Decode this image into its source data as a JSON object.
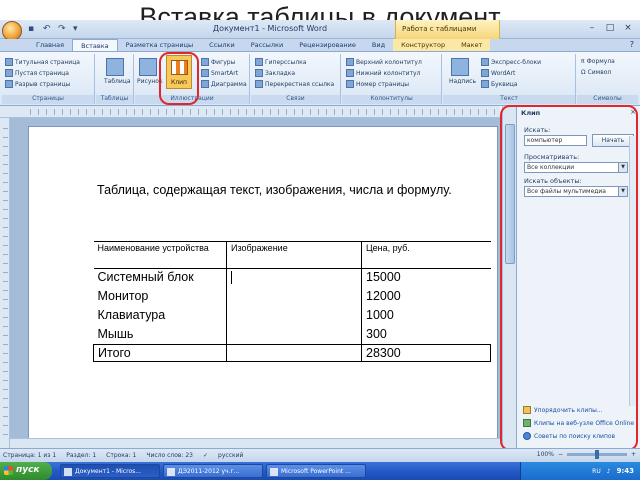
{
  "slide_title": "Вставка таблицы в документ",
  "window": {
    "title": "Документ1 - Microsoft Word",
    "context_tab": "Работа с таблицами"
  },
  "ribbon_tabs": [
    "Главная",
    "Вставка",
    "Разметка страницы",
    "Ссылки",
    "Рассылки",
    "Рецензирование",
    "Вид",
    "Конструктор",
    "Макет"
  ],
  "ribbon": {
    "pages": {
      "items": [
        "Титульная страница",
        "Пустая страница",
        "Разрыв страницы"
      ],
      "label": "Страницы"
    },
    "tables": {
      "button": "Таблица",
      "label": "Таблицы"
    },
    "illustrations": {
      "picture": "Рисунок",
      "clip": "Клип",
      "items": [
        "Фигуры",
        "SmartArt",
        "Диаграмма"
      ],
      "label": "Иллюстрации"
    },
    "links": {
      "items": [
        "Гиперссылка",
        "Закладка",
        "Перекрестная ссылка"
      ],
      "label": "Связи"
    },
    "headers": {
      "items": [
        "Верхний колонтитул",
        "Нижний колонтитул",
        "Номер страницы"
      ],
      "label": "Колонтитулы"
    },
    "text": {
      "button": "Надпись",
      "items": [
        "Экспресс-блоки",
        "WordArt",
        "Буквица"
      ],
      "label": "Текст"
    },
    "symbols": {
      "items": [
        "Формула",
        "Символ"
      ],
      "label": "Символы"
    }
  },
  "document": {
    "heading": "Таблица, содержащая текст, изображения, числа и формулу.",
    "table": {
      "headers": [
        "Наименование устройства",
        "Изображение",
        "Цена, руб."
      ],
      "rows": [
        [
          "Системный блок",
          "",
          "15000"
        ],
        [
          "Монитор",
          "",
          "12000"
        ],
        [
          "Клавиатура",
          "",
          "1000"
        ],
        [
          "Мышь",
          "",
          "300"
        ]
      ],
      "total": [
        "Итого",
        "",
        "28300"
      ]
    }
  },
  "clip_pane": {
    "title": "Клип",
    "search_label": "Искать:",
    "search_value": "компьютер",
    "go_button": "Начать",
    "scope_label": "Просматривать:",
    "scope_value": "Все коллекции",
    "types_label": "Искать объекты:",
    "types_value": "Все файлы мультимедиа",
    "links": [
      "Упорядочить клипы...",
      "Клипы на веб-узле Office Online",
      "Советы по поиску клипов"
    ]
  },
  "status_bar": {
    "page": "Страница: 1 из 1",
    "section": "Раздел: 1",
    "line": "Строка: 1",
    "words": "Число слов: 23",
    "language": "русский",
    "zoom": "100%"
  },
  "taskbar": {
    "start": "пуск",
    "tasks": [
      "Документ1 - Micros...",
      "ДЭ2011-2012 уч.г...",
      "Microsoft PowerPoint ..."
    ],
    "lang": "RU",
    "time": "9:43"
  },
  "colors": {
    "highlight": "#e0282c",
    "ribbon": "#d9e6f5",
    "taskbar": "#245ac7"
  }
}
